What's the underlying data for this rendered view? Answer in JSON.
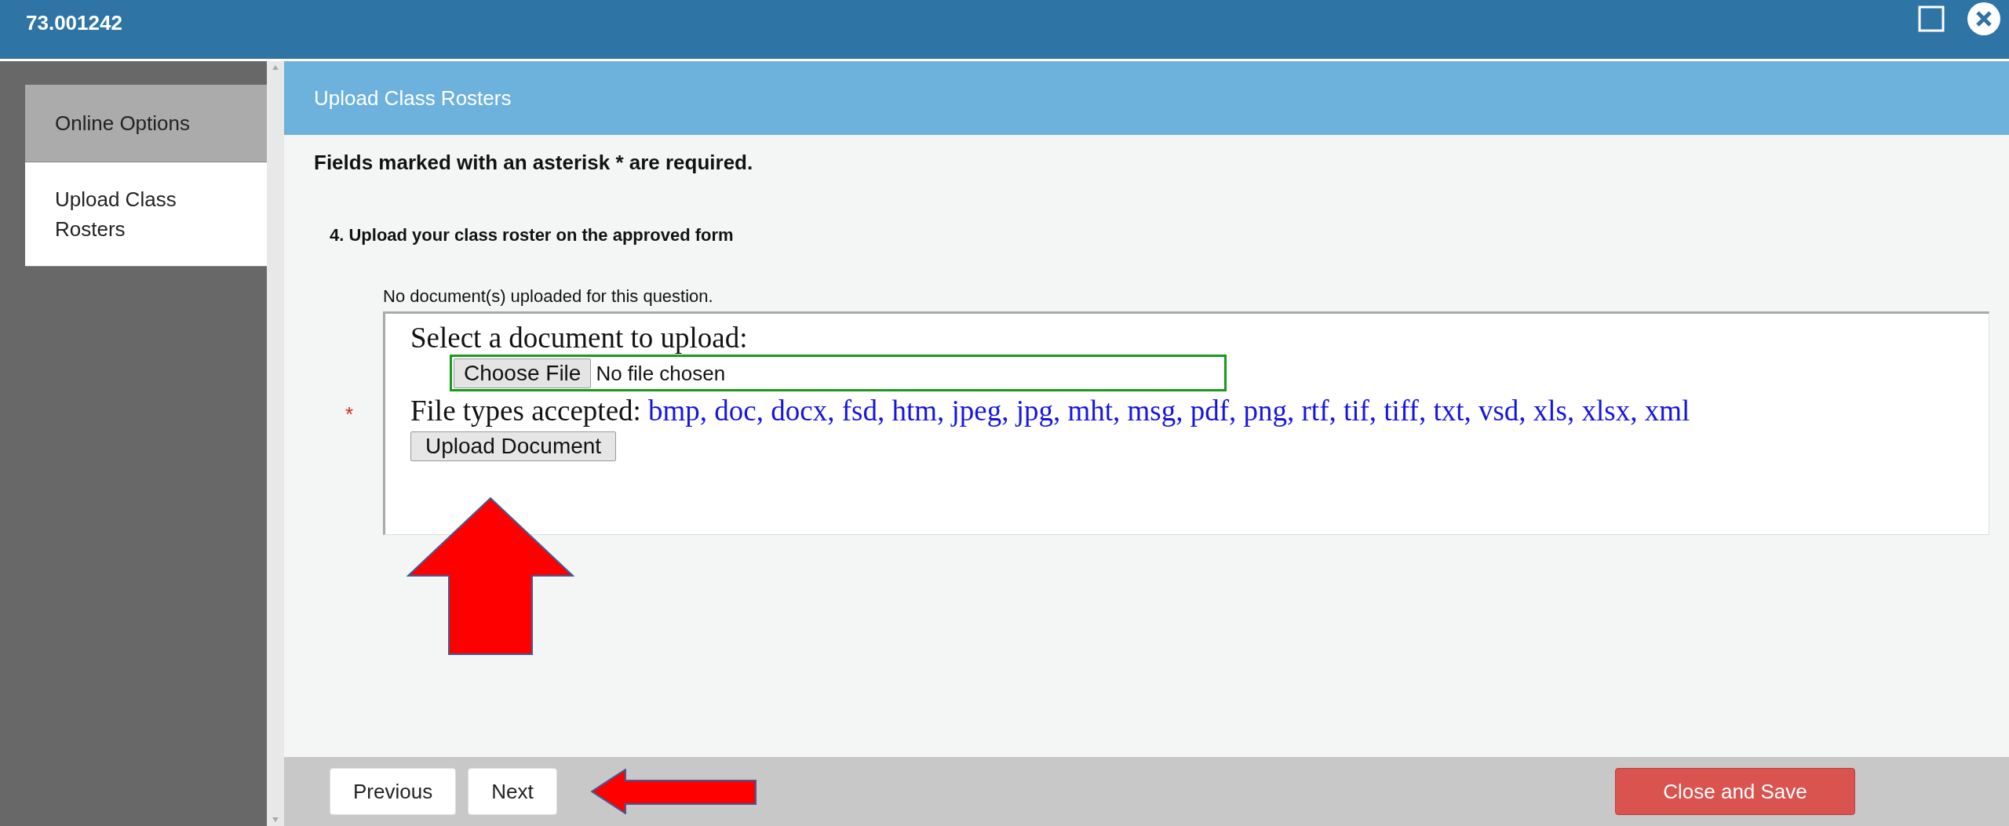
{
  "window": {
    "title": "73.001242"
  },
  "sidebar": {
    "items": [
      {
        "label": "Online Options",
        "selected": false
      },
      {
        "label": "Upload Class Rosters",
        "selected": true
      }
    ]
  },
  "page": {
    "header": "Upload Class Rosters",
    "required_note": "Fields marked with an asterisk * are required.",
    "question": {
      "title": "4. Upload your class roster on the approved form",
      "status": "No document(s) uploaded for this question.",
      "required_mark": "*",
      "prompt": "Select a document to upload:",
      "file_input": {
        "button": "Choose File",
        "value": "No file chosen"
      },
      "accepted_label": "File types accepted:",
      "accepted_types": "bmp, doc, docx, fsd, htm, jpeg, jpg, mht, msg, pdf, png, rtf, tif, tiff, txt, vsd, xls, xlsx, xml",
      "upload_button": "Upload Document"
    }
  },
  "footer": {
    "buttons": [
      {
        "label": "Previous",
        "kind": "secondary"
      },
      {
        "label": "Next",
        "kind": "secondary"
      },
      {
        "label": "Close and Save",
        "kind": "danger"
      }
    ]
  },
  "annotations": [
    {
      "kind": "up-arrow"
    },
    {
      "kind": "left-arrow"
    }
  ]
}
